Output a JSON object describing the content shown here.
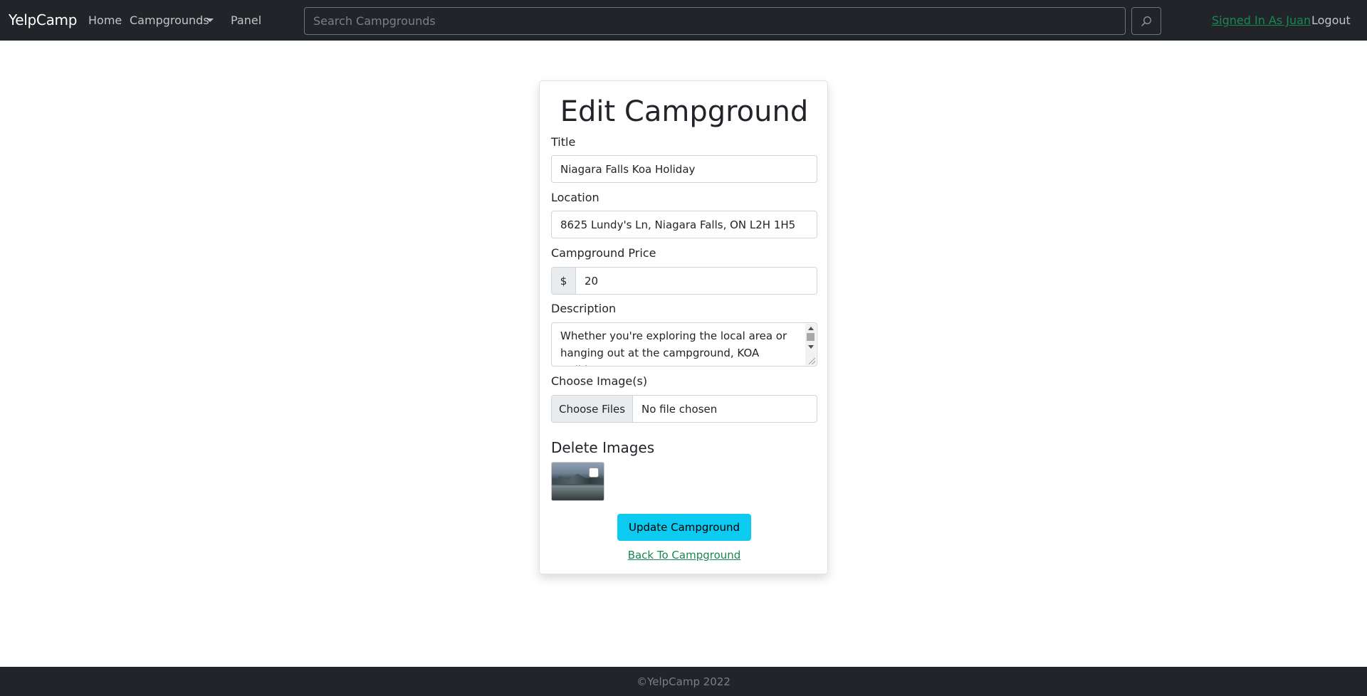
{
  "navbar": {
    "brand": "YelpCamp",
    "home": "Home",
    "campgrounds": "Campgrounds",
    "panel": "Panel",
    "search_placeholder": "Search Campgrounds",
    "signed_in": "Signed In As Juan",
    "logout": "Logout"
  },
  "form": {
    "heading": "Edit Campground",
    "title_label": "Title",
    "title_value": "Niagara Falls Koa Holiday",
    "location_label": "Location",
    "location_value": "8625 Lundy's Ln, Niagara Falls, ON L2H 1H5",
    "price_label": "Campground Price",
    "price_prefix": "$",
    "price_value": "20",
    "description_label": "Description",
    "description_value": "Whether you're exploring the local area or hanging out at the campground, KOA Holidays",
    "images_label": "Choose Image(s)",
    "file_button": "Choose Files",
    "file_status": "No file chosen",
    "delete_heading": "Delete Images",
    "update_button": "Update Campground",
    "back_link": "Back To Campground"
  },
  "footer": {
    "text": "©YelpCamp 2022"
  },
  "colors": {
    "navbar": "#212529",
    "accent_link": "#198754",
    "button": "#0dcaf0"
  },
  "icons": {
    "search": "search-icon",
    "dropdown": "chevron-down-icon"
  }
}
